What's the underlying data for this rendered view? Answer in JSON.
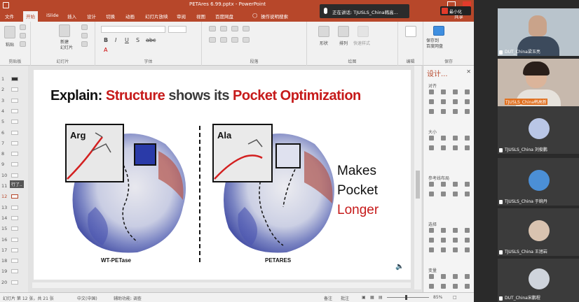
{
  "app": {
    "title": "PETAres 6.99.pptx - PowerPoint",
    "tabs": [
      "文件",
      "开始",
      "iSlide",
      "插入",
      "设计",
      "切换",
      "动画",
      "幻灯片放映",
      "审阅",
      "视图",
      "百度网盘"
    ],
    "active_tab": "开始",
    "tell_me": "操作说明搜索",
    "share": "共享"
  },
  "ribbon": {
    "clipboard": {
      "label": "剪贴板",
      "paste": "粘贴"
    },
    "slides": {
      "label": "幻灯片",
      "new_slide": "新建\n幻灯片"
    },
    "font": {
      "label": "字体"
    },
    "paragraph": {
      "label": "段落"
    },
    "drawing": {
      "label": "绘图",
      "shapes": "形状",
      "arrange": "排列",
      "quick_styles": "快速样式"
    },
    "editing": {
      "label": "编辑"
    },
    "save": {
      "label": "保存",
      "save_to": "保存到\n百度网盘"
    }
  },
  "slides_pane": {
    "numbers": [
      "1",
      "2",
      "3",
      "4",
      "5",
      "6",
      "7",
      "8",
      "9",
      "10",
      "11",
      "12",
      "13",
      "14",
      "15",
      "16",
      "17",
      "18",
      "19",
      "20"
    ],
    "selected": "12",
    "tooltip": "行了.."
  },
  "slide": {
    "title_parts": [
      {
        "text": "Explain: ",
        "style": "blk"
      },
      {
        "text": "Structure",
        "style": "red"
      },
      {
        "text": " shows its ",
        "style": "gray"
      },
      {
        "text": "Pocket Optimization",
        "style": "red"
      }
    ],
    "left_inset_label": "Arg",
    "right_inset_label": "Ala",
    "left_caption": "WT-PETase",
    "right_caption": "PETARES",
    "side_words": [
      "Makes",
      "Pocket",
      "Longer"
    ]
  },
  "design_pane": {
    "title": "设计...",
    "sections": [
      "对齐",
      "大小",
      "参考线布局",
      "选择",
      "变量"
    ]
  },
  "status": {
    "slide_info": "幻灯片 第 12 张，共 21 张",
    "language": "中文(中国)",
    "accessibility": "辅助功能: 调查",
    "notes": "备注",
    "comments": "批注",
    "zoom": "85%"
  },
  "meeting": {
    "speaking": "正在讲话: TJUSLS_China韩高...",
    "shrink": "最小化",
    "participants": [
      {
        "name": "DUT_China梁玉亮"
      },
      {
        "name": "TJUSLS_China韩高新"
      },
      {
        "name": "TJUSLS_China 刘俊鹏"
      },
      {
        "name": "TJUSLS_China 于婉丹"
      },
      {
        "name": "TJUSLS_China 王旭岩"
      },
      {
        "name": "DUT_China宋鹏程"
      }
    ]
  },
  "colors": {
    "accent": "#b7472a",
    "title_red": "#c61a1a"
  }
}
